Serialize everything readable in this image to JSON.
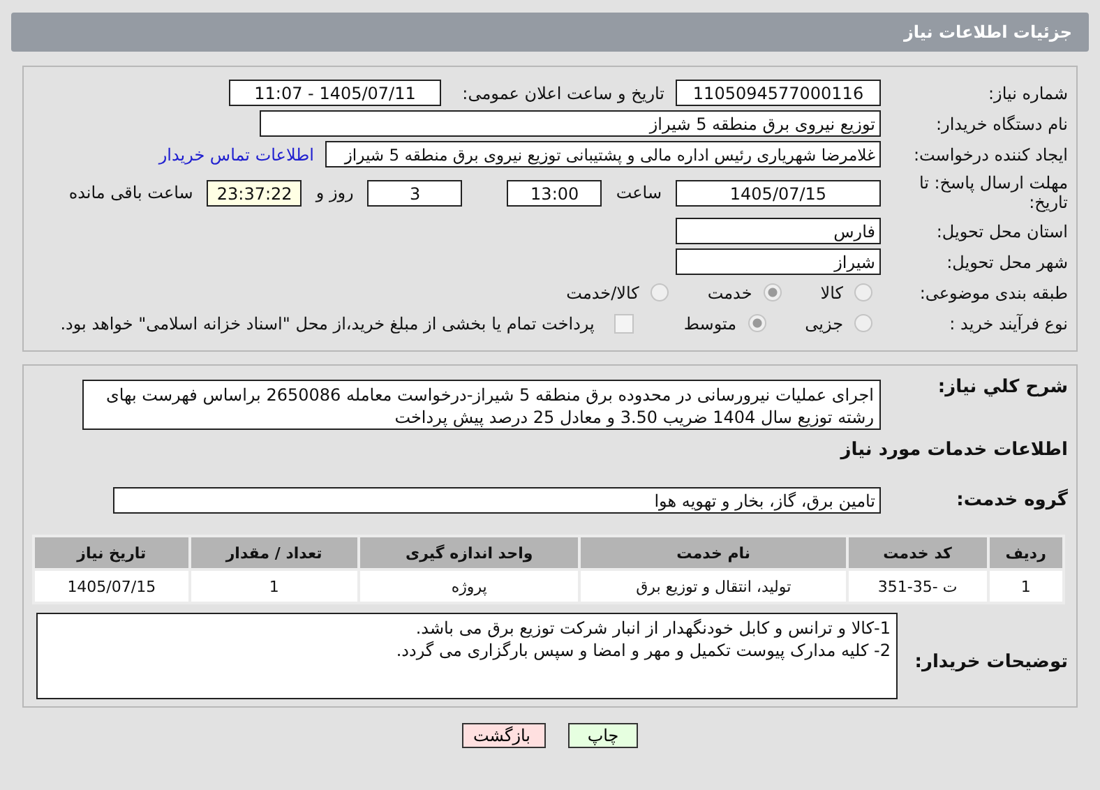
{
  "header": {
    "title": "جزئیات اطلاعات نیاز"
  },
  "need_number": {
    "label": "شماره نیاز:",
    "value": "1105094577000116"
  },
  "announce": {
    "label": "تاریخ و ساعت اعلان عمومی:",
    "value": "1405/07/11 - 11:07"
  },
  "buyer": {
    "label": "نام دستگاه خریدار:",
    "value": "توزیع نیروی برق منطقه 5 شیراز"
  },
  "requester": {
    "label": "ایجاد کننده درخواست:",
    "value": "غلامرضا شهریاری رئیس اداره مالی و پشتیبانی توزیع نیروی برق منطقه 5 شیراز",
    "link": "اطلاعات تماس خریدار"
  },
  "deadline": {
    "label": "مهلت ارسال پاسخ: تا تاریخ:",
    "date": "1405/07/15",
    "time_label": "ساعت",
    "time": "13:00",
    "days": "3",
    "days_label": "روز و",
    "remaining": "23:37:22",
    "remaining_label": "ساعت باقی مانده"
  },
  "province": {
    "label": "استان محل تحویل:",
    "value": "فارس"
  },
  "city": {
    "label": "شهر محل تحویل:",
    "value": "شیراز"
  },
  "category": {
    "label": "طبقه بندی موضوعی:",
    "options": [
      {
        "label": "کالا",
        "selected": false
      },
      {
        "label": "خدمت",
        "selected": true
      },
      {
        "label": "کالا/خدمت",
        "selected": false
      }
    ]
  },
  "purchase_type": {
    "label": "نوع فرآیند خرید :",
    "options": [
      {
        "label": "جزیی",
        "selected": false
      },
      {
        "label": "متوسط",
        "selected": true
      }
    ],
    "payment": {
      "checked": false,
      "text": "پرداخت تمام یا بخشی از مبلغ خرید،از محل \"اسناد خزانه اسلامی\" خواهد بود."
    }
  },
  "description": {
    "label": "شرح کلي نیاز:",
    "value": "اجرای عملیات نیرورسانی در محدوده برق منطقه 5 شیراز-درخواست معامله 2650086 براساس فهرست بهای رشته توزیع سال 1404 ضریب 3.50 و معادل 25 درصد پیش پرداخت"
  },
  "services_heading": "اطلاعات خدمات مورد نیاز",
  "service_group": {
    "label": "گروه خدمت:",
    "value": "تامین برق، گاز، بخار و تهویه هوا"
  },
  "table": {
    "columns": [
      "ردیف",
      "کد خدمت",
      "نام خدمت",
      "واحد اندازه گیری",
      "تعداد / مقدار",
      "تاریخ نیاز"
    ],
    "rows": [
      [
        "1",
        "ت -35-351",
        "تولید، انتقال و توزیع برق",
        "پروژه",
        "1",
        "1405/07/15"
      ]
    ]
  },
  "buyer_notes": {
    "label": "توضیحات خریدار:",
    "lines": [
      "1-کالا و ترانس و کابل خودنگهدار از انبار شرکت توزیع برق می باشد.",
      "2- کلیه مدارک پیوست تکمیل و مهر و امضا و سپس بارگزاری می گردد."
    ]
  },
  "buttons": [
    {
      "label": "چاپ",
      "kind": "print"
    },
    {
      "label": "بازگشت",
      "kind": "back"
    }
  ]
}
